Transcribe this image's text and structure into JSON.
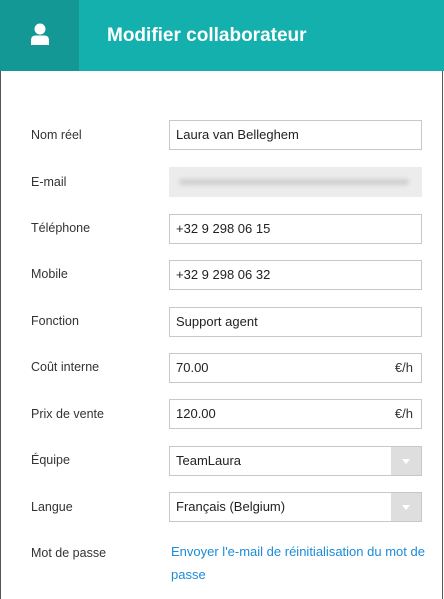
{
  "header": {
    "title": "Modifier collaborateur",
    "icon": "user-icon"
  },
  "form": {
    "real_name": {
      "label": "Nom réel",
      "value": "Laura van Belleghem"
    },
    "email": {
      "label": "E-mail"
    },
    "phone": {
      "label": "Téléphone",
      "value": "+32 9 298 06 15"
    },
    "mobile": {
      "label": "Mobile",
      "value": "+32 9 298 06 32"
    },
    "function": {
      "label": "Fonction",
      "value": "Support agent"
    },
    "internal_cost": {
      "label": "Coût interne",
      "value": "70.00",
      "unit": "€/h"
    },
    "sale_price": {
      "label": "Prix de vente",
      "value": "120.00",
      "unit": "€/h"
    },
    "team": {
      "label": "Équipe",
      "value": "TeamLaura"
    },
    "language": {
      "label": "Langue",
      "value": "Français (Belgium)"
    },
    "password": {
      "label": "Mot de passe",
      "link": "Envoyer l'e-mail de réinitialisation du mot de passe"
    }
  },
  "colors": {
    "header": "#14b0ad",
    "header_icon_bg": "#149896",
    "link": "#1a8cd8"
  }
}
